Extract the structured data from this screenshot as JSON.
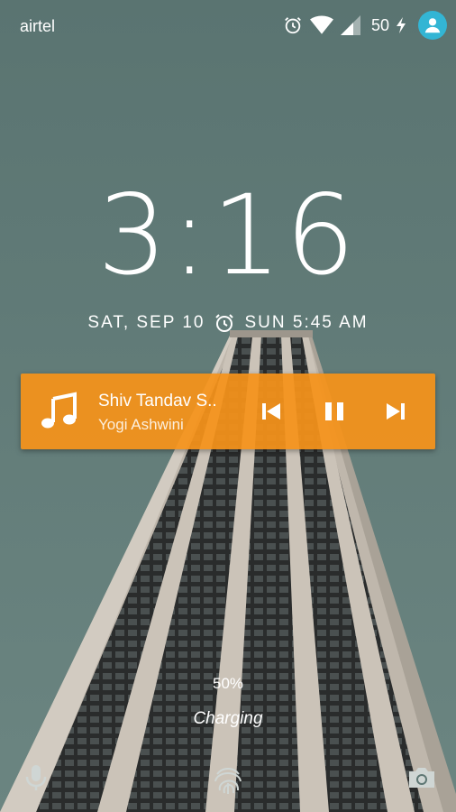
{
  "status_bar": {
    "carrier": "airtel",
    "battery_level": "50",
    "icons": [
      "alarm-icon",
      "wifi-icon",
      "cell-signal-icon",
      "charging-bolt-icon",
      "user-avatar-icon"
    ]
  },
  "lock_screen": {
    "time": "3:16",
    "date": "SAT, SEP 10",
    "next_alarm": "SUN 5:45 AM"
  },
  "media": {
    "title": "Shiv Tandav S..",
    "artist": "Yogi Ashwini",
    "accent_color": "#F5921A",
    "controls": [
      "previous-icon",
      "pause-icon",
      "next-icon"
    ]
  },
  "charging": {
    "percent": "50%",
    "status": "Charging"
  },
  "bottom_shortcuts": [
    "mic-icon",
    "fingerprint-icon",
    "camera-icon"
  ]
}
